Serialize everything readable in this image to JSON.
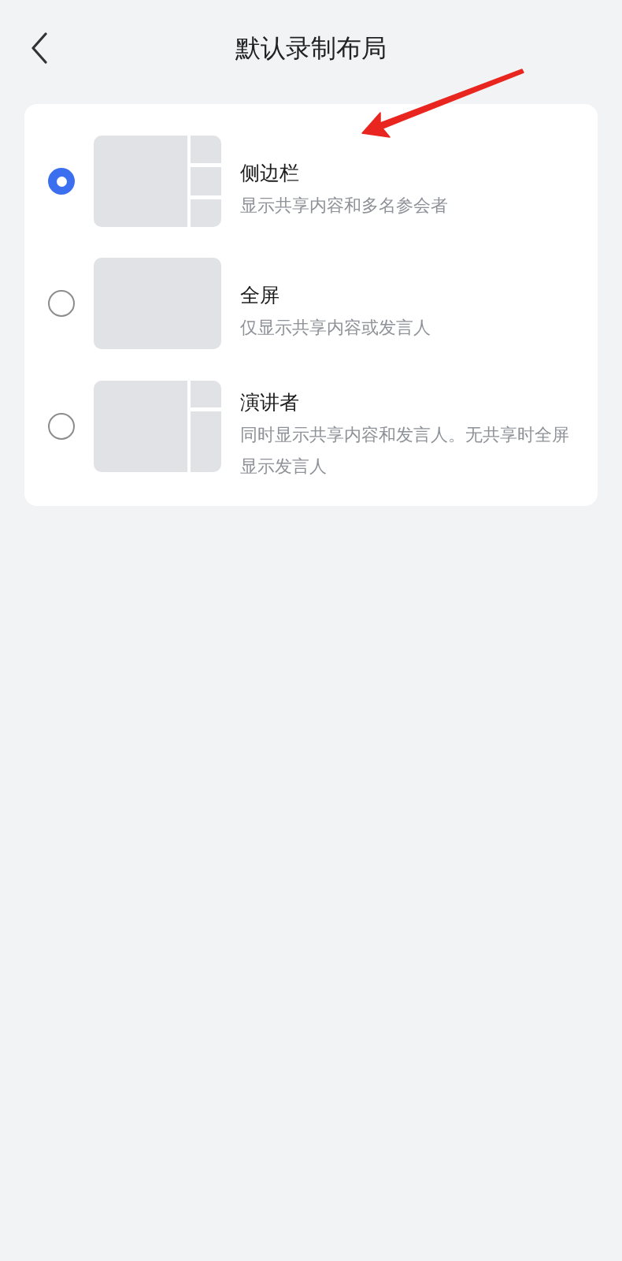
{
  "header": {
    "title": "默认录制布局"
  },
  "options": [
    {
      "kind": "sidebar",
      "title": "侧边栏",
      "description": "显示共享内容和多名参会者",
      "selected": true
    },
    {
      "kind": "fullscreen",
      "title": "全屏",
      "description": "仅显示共享内容或发言人",
      "selected": false
    },
    {
      "kind": "speaker",
      "title": "演讲者",
      "description": "同时显示共享内容和发言人。无共享时全屏显示发言人",
      "selected": false
    }
  ],
  "annotations": [
    {
      "kind": "arrow"
    }
  ]
}
